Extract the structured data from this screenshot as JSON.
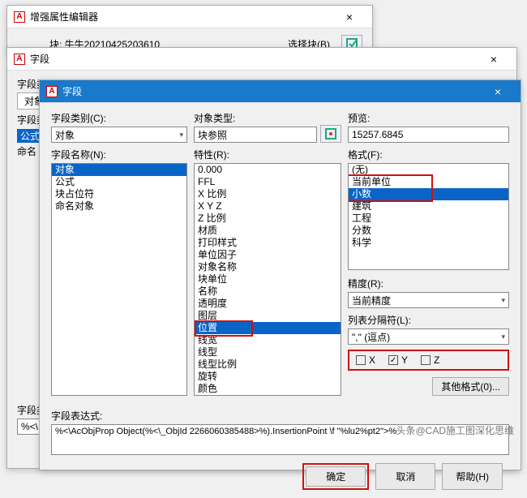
{
  "win0": {
    "title": "增强属性编辑器",
    "block_label": "块: 牛牛20210425203610",
    "select_btn": "选择块(B)"
  },
  "win1": {
    "title": "字段",
    "row_cat_label": "字段类别",
    "tab": "对象",
    "row_cat2_label": "字段类",
    "highlighted": "公式",
    "row_names_label": "命名",
    "combo": "对象",
    "row_expr_label": "字段类",
    "expr_prefix": "%<\\"
  },
  "win2": {
    "title": "字段",
    "cat_label": "字段类别(C):",
    "cat_value": "对象",
    "names_label": "字段名称(N):",
    "names": [
      "对象",
      "公式",
      "块占位符",
      "命名对象"
    ],
    "names_sel": 0,
    "objtype_label": "对象类型:",
    "objtype_value": "块参照",
    "props_label": "特性(R):",
    "props": [
      "0.000",
      "FFL",
      "X 比例",
      "X Y Z",
      "Z 比例",
      "材质",
      "打印样式",
      "单位因子",
      "对象名称",
      "块单位",
      "名称",
      "透明度",
      "图层",
      "位置",
      "线宽",
      "线型",
      "线型比例",
      "旋转",
      "颜色"
    ],
    "props_sel": 13,
    "preview_label": "预览:",
    "preview_value": "15257.6845",
    "format_label": "格式(F):",
    "formats": [
      "(无)",
      "当前单位",
      "小数",
      "建筑",
      "工程",
      "分数",
      "科学"
    ],
    "formats_sel": 2,
    "precision_label": "精度(R):",
    "precision_value": "当前精度",
    "listsep_label": "列表分隔符(L):",
    "listsep_value": "\",\" (逗点)",
    "xyz": {
      "x": "X",
      "y": "Y",
      "z": "Z",
      "x_checked": false,
      "y_checked": true,
      "z_checked": false
    },
    "other_fmt": "其他格式(0)...",
    "expr_label": "字段表达式:",
    "expr_value": "%<\\AcObjProp Object(%<\\_ObjId 2266060385488>%).InsertionPoint \\f \"%lu2%pt2\">%",
    "ok": "确定",
    "cancel": "取消",
    "help": "帮助(H)"
  },
  "watermark": "头条@CAD施工图深化思维"
}
